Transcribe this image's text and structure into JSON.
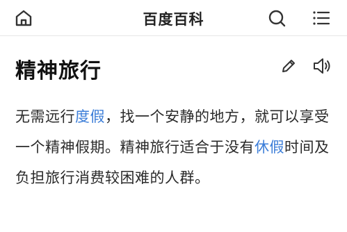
{
  "topbar": {
    "home_icon": "home-icon",
    "title": "百度百科",
    "search_icon": "search-icon",
    "menu_icon": "menu-icon"
  },
  "entry": {
    "title": "精神旅行",
    "edit_icon": "pencil-icon",
    "voice_icon": "speaker-icon"
  },
  "content": {
    "seg1": "无需远行",
    "link1": "度假",
    "seg2": "，找一个安静的地方，就可以享受一个精神假期。精神旅行适合于没有",
    "link2": "休假",
    "seg3": "时间及负担旅行消费较困难的人群。"
  },
  "colors": {
    "link": "#3b7dd8",
    "text": "#2a2a2a",
    "icon": "#333333"
  }
}
